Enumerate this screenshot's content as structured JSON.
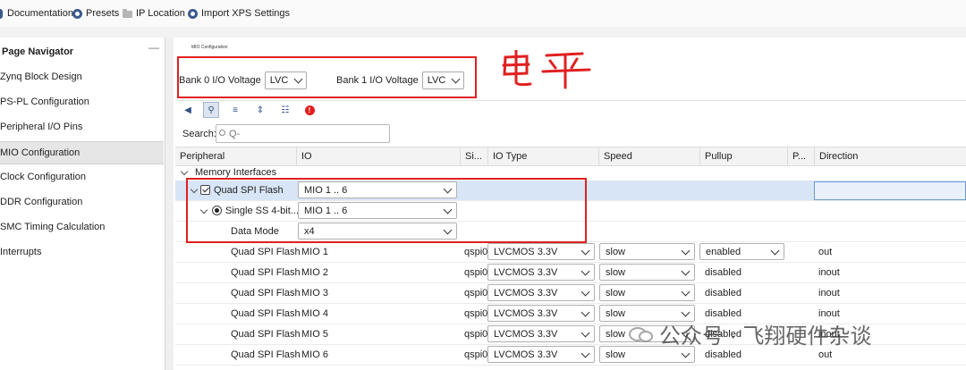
{
  "toolbar": {
    "items": [
      {
        "label": "Documentation",
        "icon": "help-icon"
      },
      {
        "label": "Presets",
        "icon": "gear-icon"
      },
      {
        "label": "IP Location",
        "icon": "folder-icon"
      },
      {
        "label": "Import XPS Settings",
        "icon": "gear-icon"
      }
    ]
  },
  "nav": {
    "title": "Page Navigator",
    "minimize": "—",
    "items": [
      {
        "label": "Zynq Block Design"
      },
      {
        "label": "PS-PL Configuration"
      },
      {
        "label": "Peripheral I/O Pins"
      },
      {
        "label": "MIO Configuration",
        "selected": true
      },
      {
        "label": "Clock Configuration"
      },
      {
        "label": "DDR Configuration"
      },
      {
        "label": "SMC Timing Calculation"
      },
      {
        "label": "Interrupts"
      }
    ]
  },
  "main": {
    "header": "MIO Configuration",
    "bank0": {
      "label": "Bank 0 I/O Voltage",
      "value": "LVC"
    },
    "bank1": {
      "label": "Bank 1 I/O Voltage",
      "value": "LVC"
    },
    "annotation": "电平",
    "search": {
      "label": "Search:",
      "placeholder": "Q-"
    },
    "columns": [
      "Peripheral",
      "IO",
      "Si...",
      "IO Type",
      "Speed",
      "Pullup",
      "P...",
      "Direction"
    ],
    "group": "Memory Interfaces",
    "qspi": {
      "label": "Quad SPI Flash",
      "io": "MIO 1 .. 6"
    },
    "single": {
      "label": "Single SS 4-bit...",
      "io": "MIO 1 .. 6"
    },
    "datamode": {
      "label": "Data Mode",
      "value": "x4"
    },
    "rows": [
      {
        "peripheral": "Quad SPI Flash",
        "io": "MIO 1",
        "signal": "qspi0",
        "io_type": "LVCMOS 3.3V",
        "speed": "slow",
        "pullup": "enabled",
        "direction": "out"
      },
      {
        "peripheral": "Quad SPI Flash",
        "io": "MIO 2",
        "signal": "qspi0",
        "io_type": "LVCMOS 3.3V",
        "speed": "slow",
        "pullup": "disabled",
        "direction": "inout"
      },
      {
        "peripheral": "Quad SPI Flash",
        "io": "MIO 3",
        "signal": "qspi0",
        "io_type": "LVCMOS 3.3V",
        "speed": "slow",
        "pullup": "disabled",
        "direction": "inout"
      },
      {
        "peripheral": "Quad SPI Flash",
        "io": "MIO 4",
        "signal": "qspi0",
        "io_type": "LVCMOS 3.3V",
        "speed": "slow",
        "pullup": "disabled",
        "direction": "inout"
      },
      {
        "peripheral": "Quad SPI Flash",
        "io": "MIO 5",
        "signal": "qspi0",
        "io_type": "LVCMOS 3.3V",
        "speed": "slow",
        "pullup": "disabled",
        "direction": "inout"
      },
      {
        "peripheral": "Quad SPI Flash",
        "io": "MIO 6",
        "signal": "qspi0",
        "io_type": "LVCMOS 3.3V",
        "speed": "slow",
        "pullup": "disabled",
        "direction": "out"
      }
    ]
  },
  "watermark": "公众号 · 飞翔硬件杂谈",
  "colors": {
    "highlight_box": "#e02020",
    "selected_row": "#d7e5f7",
    "accent": "#2e4f86"
  }
}
